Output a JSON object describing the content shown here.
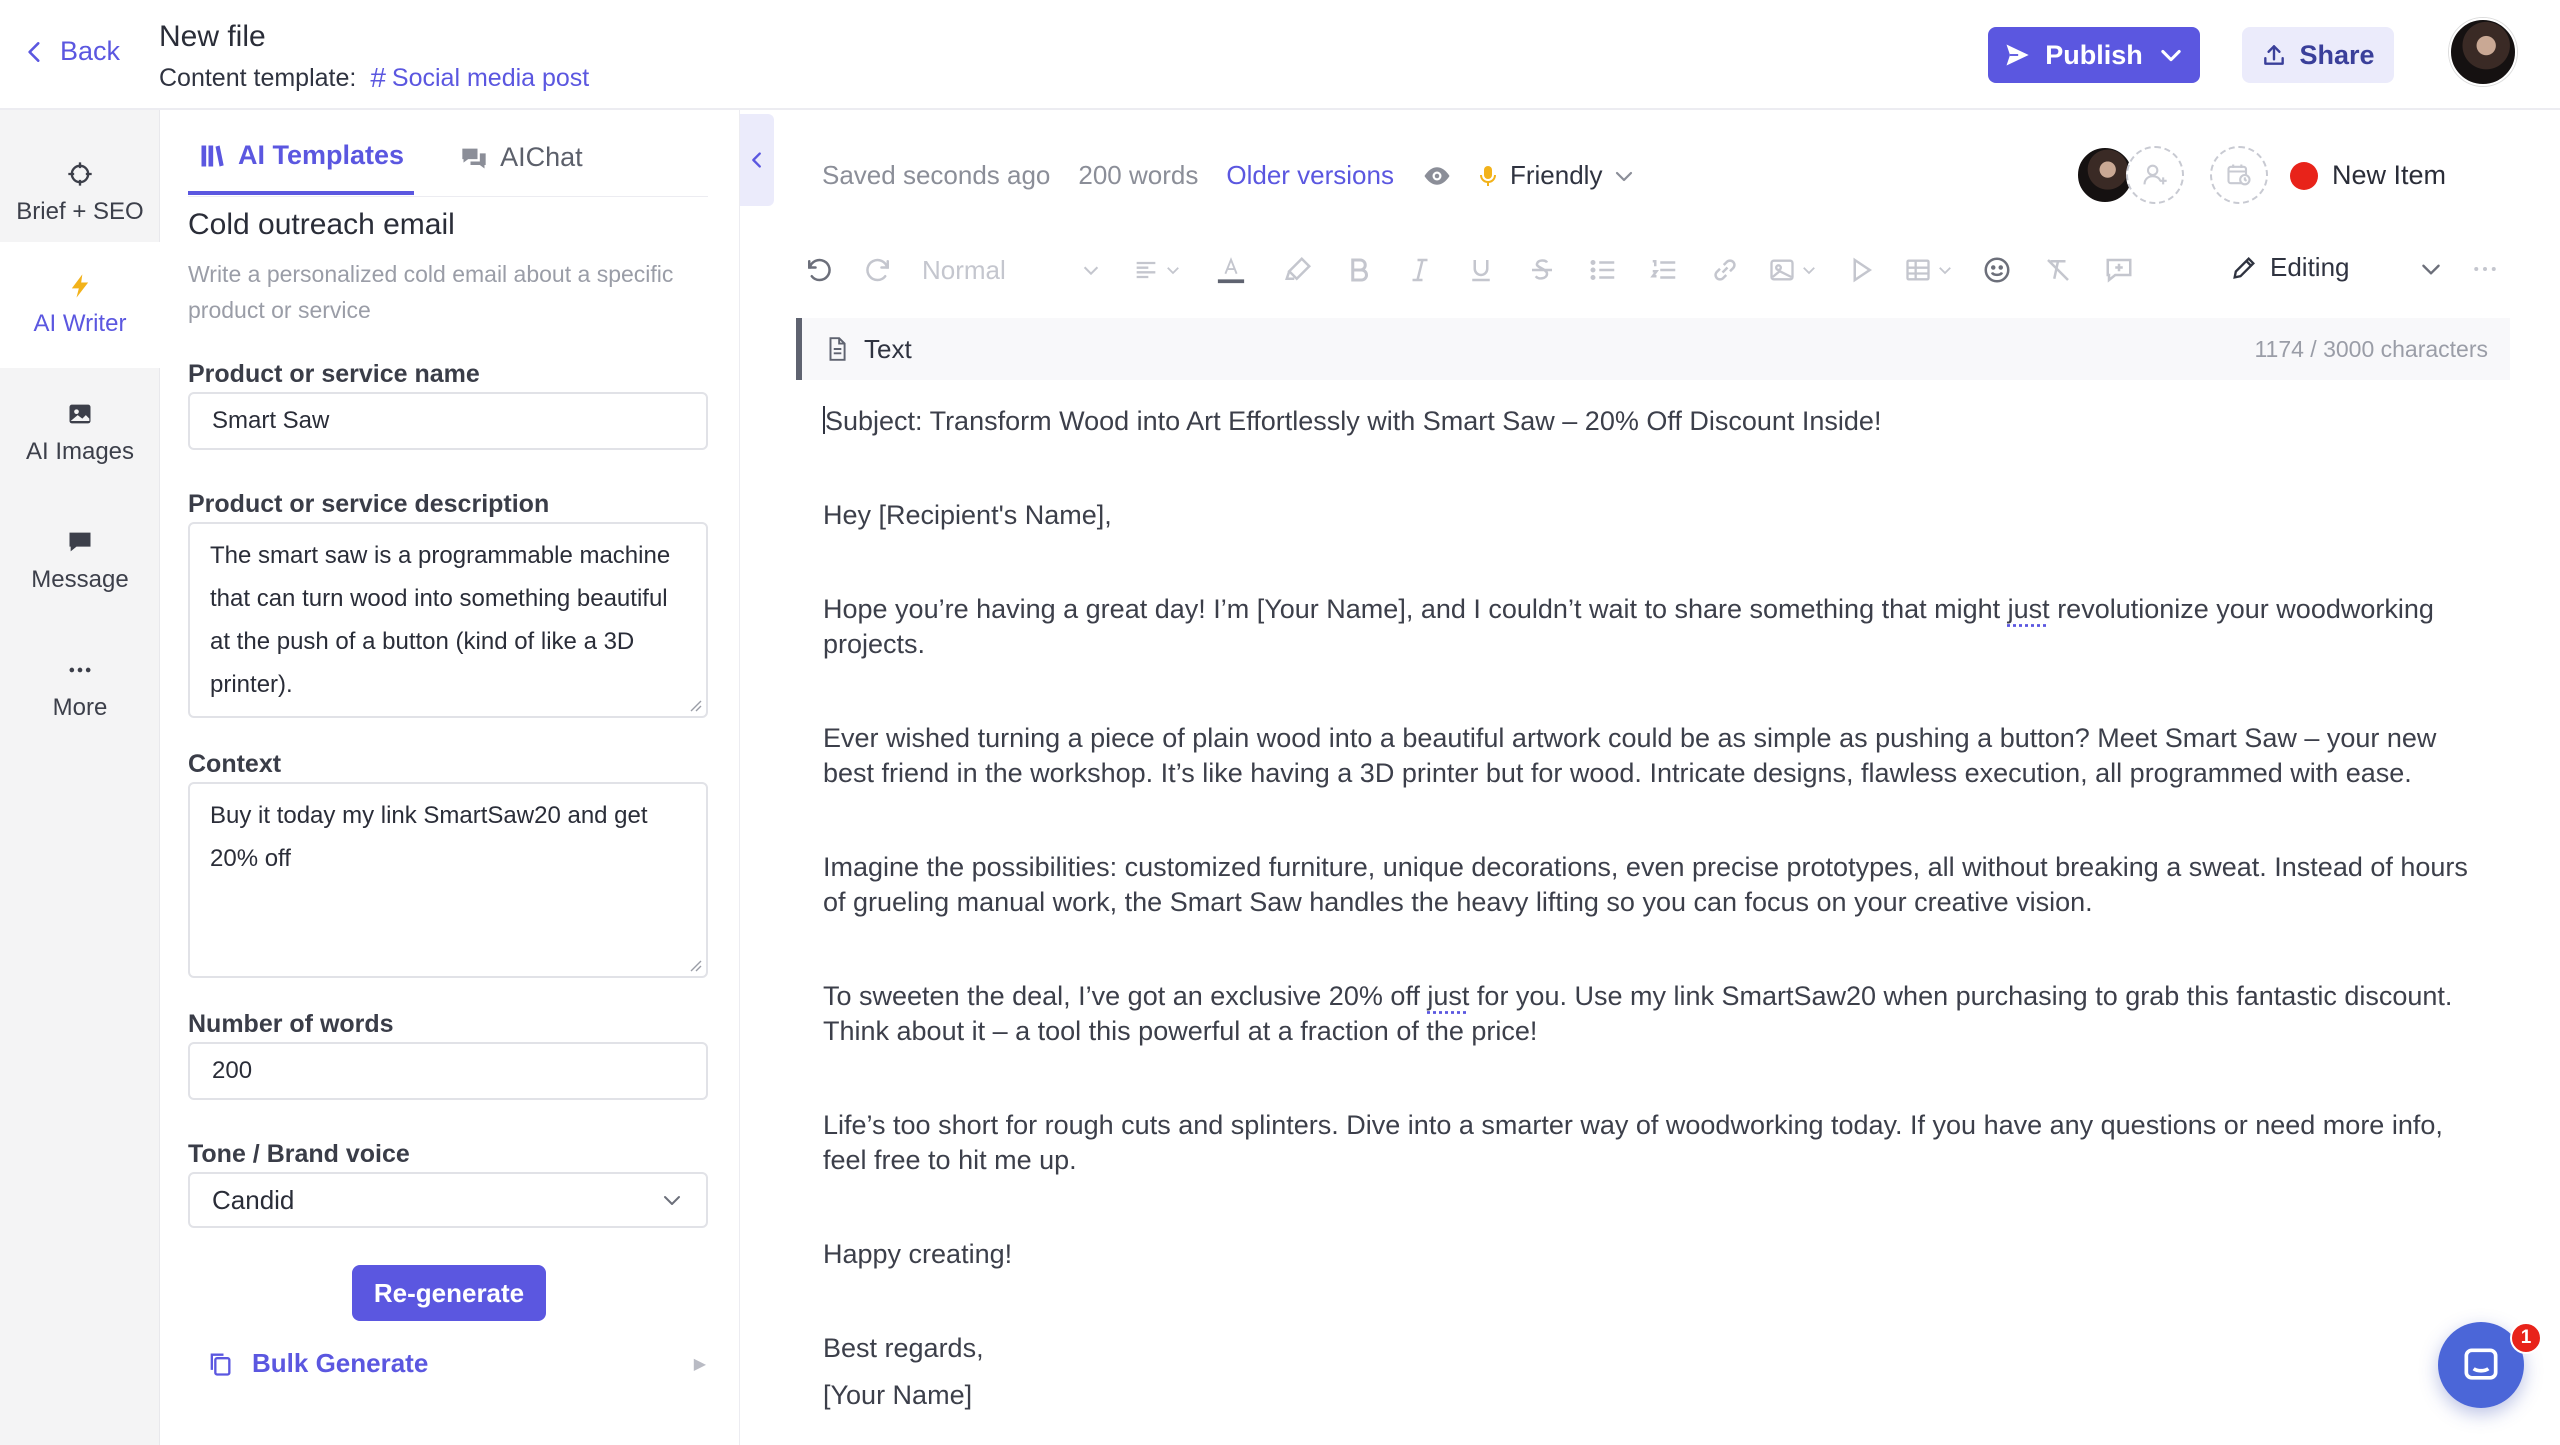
{
  "header": {
    "back_label": "Back",
    "file_title": "New file",
    "template_prefix": "Content template:",
    "template_name": "Social media post",
    "publish_label": "Publish",
    "share_label": "Share"
  },
  "rail": {
    "items": [
      {
        "label": "Brief + SEO",
        "icon": "crosshair-icon",
        "active": false
      },
      {
        "label": "AI Writer",
        "icon": "lightning-icon",
        "active": true
      },
      {
        "label": "AI Images",
        "icon": "image-icon",
        "active": false
      },
      {
        "label": "Message",
        "icon": "message-icon",
        "active": false
      },
      {
        "label": "More",
        "icon": "ellipsis-icon",
        "active": false
      }
    ]
  },
  "panel": {
    "tabs": [
      {
        "label": "AI Templates",
        "icon": "library-icon",
        "active": true
      },
      {
        "label": "AIChat",
        "icon": "chat-bubbles-icon",
        "active": false
      }
    ],
    "template_title": "Cold outreach email",
    "template_description": "Write a personalized cold email about a specific product or service",
    "fields": {
      "product_name_label": "Product or service name",
      "product_name_value": "Smart Saw",
      "product_desc_label": "Product or service description",
      "product_desc_value": "The smart saw is a programmable machine that can turn wood into something beautiful at the push of a button (kind of like a 3D printer).",
      "context_label": "Context",
      "context_value": "Buy it today my link SmartSaw20 and get 20% off",
      "words_label": "Number of words",
      "words_value": "200",
      "tone_label": "Tone / Brand voice",
      "tone_value": "Candid"
    },
    "regenerate_label": "Re-generate",
    "bulk_label": "Bulk Generate"
  },
  "editor": {
    "saved_status": "Saved seconds ago",
    "word_count": "200 words",
    "older_versions": "Older versions",
    "tone": "Friendly",
    "new_item": "New Item",
    "toolbar": {
      "block_style": "Normal",
      "mode": "Editing"
    },
    "block_label": "Text",
    "char_count": "1174 / 3000 characters",
    "content": {
      "subject": "Subject: Transform Wood into Art Effortlessly with Smart Saw – 20% Off Discount Inside!",
      "greeting": "Hey [Recipient's Name],",
      "p1_a": "Hope you’re having a great day! I’m [Your Name], and I couldn’t wait to share something that might ",
      "p1_just": "just",
      "p1_b": " revolutionize your woodworking projects.",
      "p2": "Ever wished turning a piece of plain wood into a beautiful artwork could be as simple as pushing a button? Meet Smart Saw – your new best friend in the workshop. It’s like having a 3D printer but for wood. Intricate designs, flawless execution, all programmed with ease.",
      "p3": "Imagine the possibilities: customized furniture, unique decorations, even precise prototypes, all without breaking a sweat. Instead of hours of grueling manual work, the Smart Saw handles the heavy lifting so you can focus on your creative vision.",
      "p4_a": "To sweeten the deal, I’ve got an exclusive 20% off ",
      "p4_just": "just",
      "p4_b": " for you. Use my link SmartSaw20 when purchasing to grab this fantastic discount. Think about it – a tool this powerful at a fraction of the price!",
      "p5": "Life’s too short for rough cuts and splinters. Dive into a smarter way of woodworking today. If you have any questions or need more info, feel free to hit me up.",
      "p6": "Happy creating!",
      "signoff": "Best regards,",
      "signature": "[Your Name]"
    }
  },
  "chat_widget": {
    "badge": "1"
  },
  "colors": {
    "accent": "#5b57e0",
    "status_dot": "#e8231a",
    "chat_button": "#4b66d8"
  }
}
